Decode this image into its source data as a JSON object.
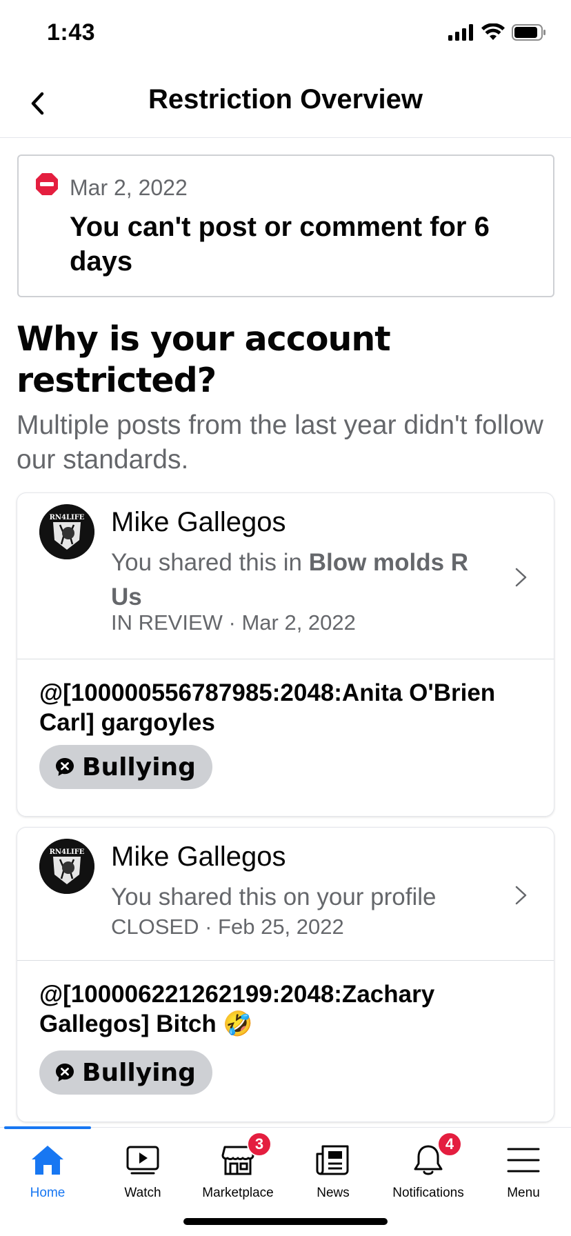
{
  "status_bar": {
    "time": "1:43"
  },
  "header": {
    "title": "Restriction Overview"
  },
  "restriction": {
    "date": "Mar 2, 2022",
    "message": "You can't post or comment for 6 days"
  },
  "why": {
    "title": "Why is your account restricted?",
    "subtitle": "Multiple posts from the last year didn't follow our standards."
  },
  "posts": [
    {
      "author": "Mike Gallegos",
      "shared_prefix": "You shared this in ",
      "shared_group": "Blow molds R Us",
      "status": "IN REVIEW",
      "date": "Mar 2, 2022",
      "separator": " · ",
      "body": "@[100000556787985:2048:Anita O'Brien Carl] gargoyles",
      "tag": "Bullying",
      "avatar_text": "RN4LIFE"
    },
    {
      "author": "Mike Gallegos",
      "shared_prefix": "You shared this on your profile",
      "shared_group": "",
      "status": "CLOSED",
      "date": "Feb 25, 2022",
      "separator": " · ",
      "body": "@[100006221262199:2048:Zachary Gallegos] Bitch 🤣",
      "tag": "Bullying",
      "avatar_text": "RN4LIFE"
    }
  ],
  "nav": {
    "items": [
      {
        "label": "Home",
        "icon": "home-icon",
        "active": true
      },
      {
        "label": "Watch",
        "icon": "watch-icon"
      },
      {
        "label": "Marketplace",
        "icon": "marketplace-icon",
        "badge": "3"
      },
      {
        "label": "News",
        "icon": "news-icon"
      },
      {
        "label": "Notifications",
        "icon": "bell-icon",
        "badge": "4"
      },
      {
        "label": "Menu",
        "icon": "menu-icon"
      }
    ]
  },
  "colors": {
    "accent": "#1877f2",
    "badge": "#e41e3f",
    "restrict_red": "#e41e3f",
    "muted_text": "#65676b"
  }
}
